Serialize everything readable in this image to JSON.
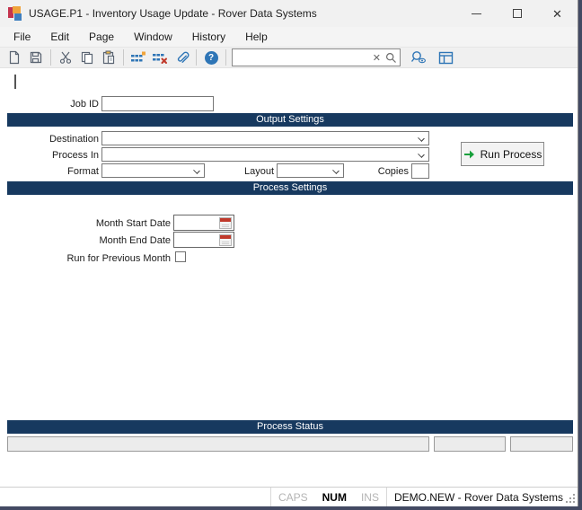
{
  "window": {
    "title": "USAGE.P1 - Inventory Usage Update - Rover Data Systems"
  },
  "menu": {
    "items": [
      "File",
      "Edit",
      "Page",
      "Window",
      "History",
      "Help"
    ]
  },
  "toolbar": {
    "icon_names": [
      "new-document-icon",
      "save-icon",
      "cut-icon",
      "copy-icon",
      "paste-icon",
      "insert-rows-icon",
      "delete-rows-icon",
      "attachment-icon",
      "help-icon",
      "search-clear-icon",
      "search-icon",
      "find-preview-icon",
      "layout-panel-icon"
    ],
    "help_glyph": "?",
    "search": {
      "value": "",
      "placeholder": "",
      "clear_glyph": "✕"
    }
  },
  "form": {
    "job_id": {
      "label": "Job ID",
      "value": ""
    },
    "output_settings": {
      "header": "Output Settings",
      "destination": {
        "label": "Destination",
        "value": ""
      },
      "process_in": {
        "label": "Process In",
        "value": ""
      },
      "format": {
        "label": "Format",
        "value": ""
      },
      "layout": {
        "label": "Layout",
        "value": ""
      },
      "copies": {
        "label": "Copies",
        "value": ""
      },
      "run_button_label": "Run Process"
    },
    "process_settings": {
      "header": "Process Settings",
      "month_start": {
        "label": "Month Start Date",
        "value": ""
      },
      "month_end": {
        "label": "Month End Date",
        "value": ""
      },
      "previous_month": {
        "label": "Run for Previous Month",
        "checked": false
      }
    },
    "process_status": {
      "header": "Process Status",
      "fields": [
        "",
        "",
        ""
      ]
    }
  },
  "status_bar": {
    "caps": "CAPS",
    "num": "NUM",
    "ins": "INS",
    "session": "DEMO.NEW - Rover Data Systems"
  },
  "colors": {
    "section_header_bg": "#17395f",
    "accent_blue": "#2e75b6",
    "run_arrow_green": "#18a03c",
    "calendar_red": "#c0392b",
    "titlebar_bg": "#f1f1f1"
  }
}
